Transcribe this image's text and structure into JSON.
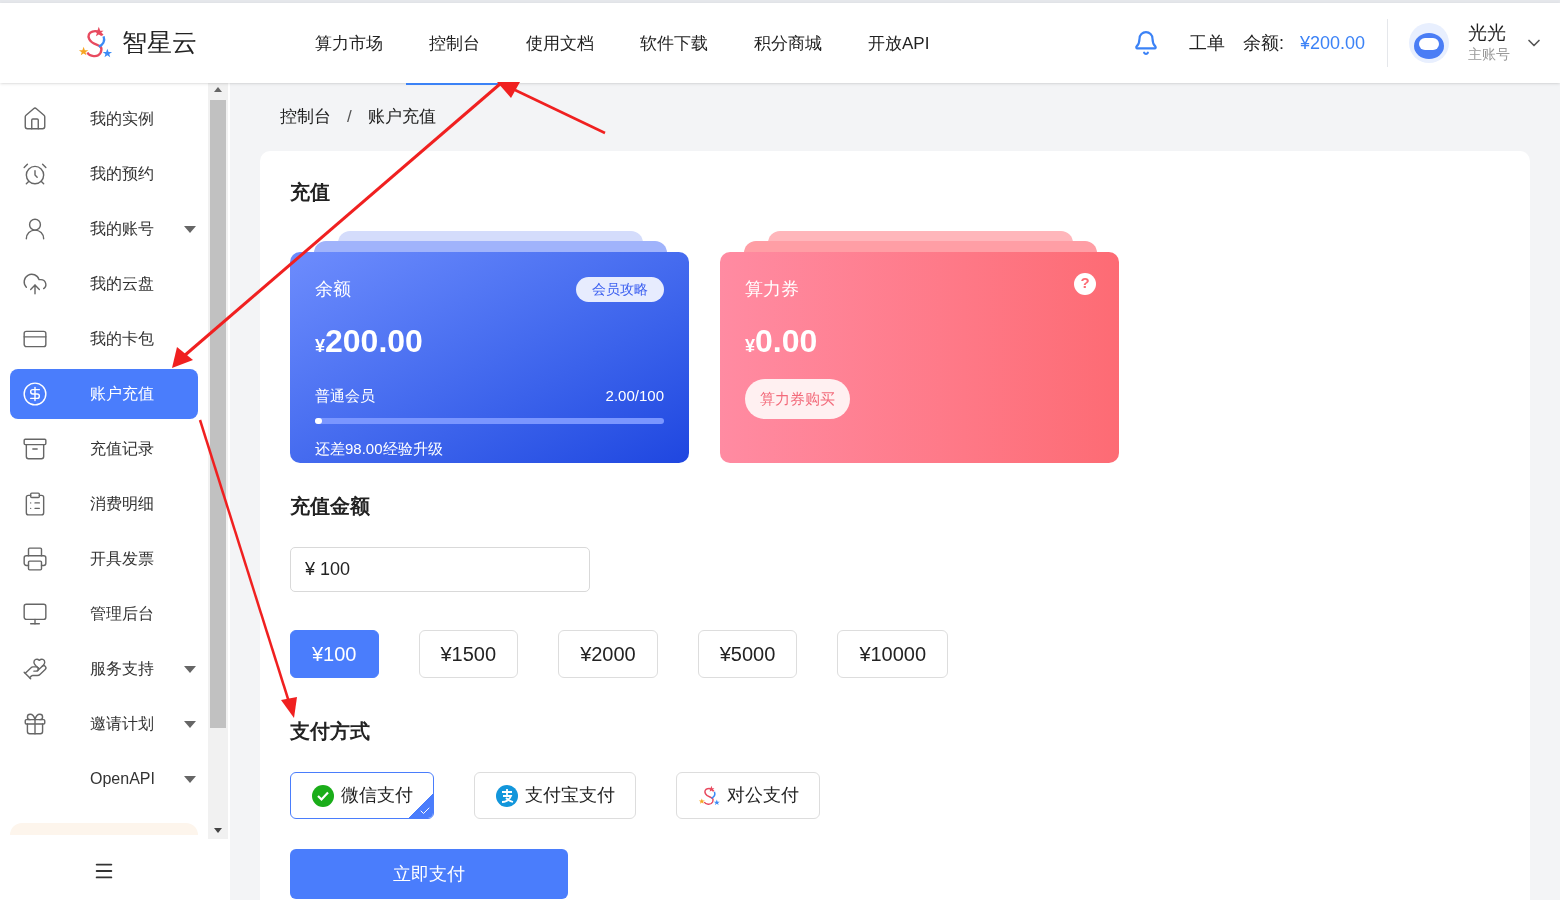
{
  "header": {
    "brand": "智星云",
    "nav": [
      {
        "label": "算力市场",
        "selected": false
      },
      {
        "label": "控制台",
        "selected": true
      },
      {
        "label": "使用文档",
        "selected": false
      },
      {
        "label": "软件下载",
        "selected": false
      },
      {
        "label": "积分商城",
        "selected": false
      },
      {
        "label": "开放API",
        "selected": false
      }
    ],
    "work_order": "工单",
    "balance_label": "余额:",
    "balance": "¥200.00",
    "user": {
      "name": "光光",
      "role": "主账号"
    }
  },
  "sidebar": {
    "items": [
      {
        "label": "我的实例",
        "selected": false,
        "expandable": false
      },
      {
        "label": "我的预约",
        "selected": false,
        "expandable": false
      },
      {
        "label": "我的账号",
        "selected": false,
        "expandable": true
      },
      {
        "label": "我的云盘",
        "selected": false,
        "expandable": false
      },
      {
        "label": "我的卡包",
        "selected": false,
        "expandable": false
      },
      {
        "label": "账户充值",
        "selected": true,
        "expandable": false
      },
      {
        "label": "充值记录",
        "selected": false,
        "expandable": false
      },
      {
        "label": "消费明细",
        "selected": false,
        "expandable": false
      },
      {
        "label": "开具发票",
        "selected": false,
        "expandable": false
      },
      {
        "label": "管理后台",
        "selected": false,
        "expandable": false
      },
      {
        "label": "服务支持",
        "selected": false,
        "expandable": true
      },
      {
        "label": "邀请计划",
        "selected": false,
        "expandable": true
      },
      {
        "label": "OpenAPI",
        "selected": false,
        "expandable": true
      }
    ]
  },
  "breadcrumb": [
    {
      "kind": "link",
      "text": "控制台"
    },
    {
      "kind": "separator",
      "text": "/"
    },
    {
      "kind": "current",
      "text": "账户充值"
    }
  ],
  "recharge": {
    "title": "充值",
    "balance_card": {
      "label": "余额",
      "badge": "会员攻略",
      "currency": "¥",
      "amount": "200.00",
      "tier": "普通会员",
      "progress": "2.00/100",
      "level": 0.02,
      "hint": "还差98.00经验升级"
    },
    "voucher_card": {
      "label": "算力券",
      "help": "?",
      "currency": "¥",
      "amount": "0.00",
      "button": "算力券购买"
    },
    "amount_title": "充值金额",
    "amount_input": "¥ 100",
    "presets": [
      {
        "label": "¥100",
        "selected": true
      },
      {
        "label": "¥1500",
        "selected": false
      },
      {
        "label": "¥2000",
        "selected": false
      },
      {
        "label": "¥5000",
        "selected": false
      },
      {
        "label": "¥10000",
        "selected": false
      }
    ],
    "pay_title": "支付方式",
    "methods": [
      {
        "kind": "wechat",
        "label": "微信支付",
        "selected": true
      },
      {
        "kind": "alipay",
        "label": "支付宝支付",
        "selected": false
      },
      {
        "kind": "corporate",
        "label": "对公支付",
        "selected": false
      }
    ],
    "pay_button": "立即支付"
  }
}
